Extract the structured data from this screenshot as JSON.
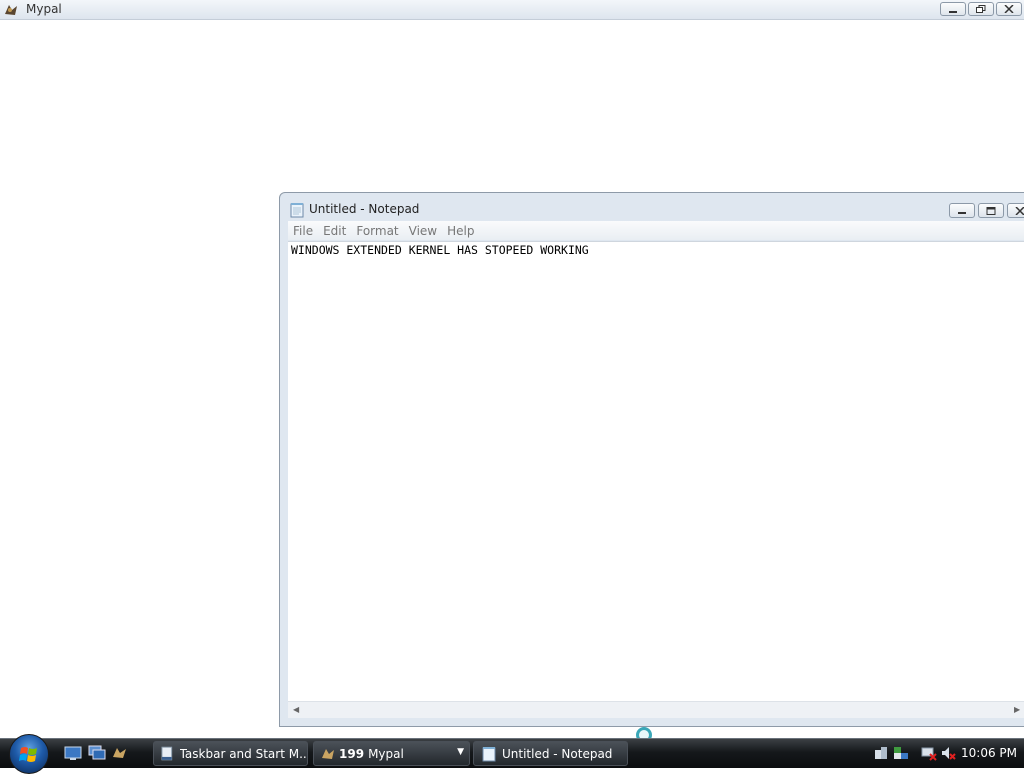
{
  "mypal": {
    "title": "Mypal"
  },
  "notepad": {
    "title": "Untitled - Notepad",
    "menus": [
      "File",
      "Edit",
      "Format",
      "View",
      "Help"
    ],
    "content": "WINDOWS EXTENDED KERNEL HAS STOPEED WORKING"
  },
  "taskbar": {
    "tasks": [
      {
        "label": "Taskbar and Start M..."
      },
      {
        "count": "199",
        "label": "Mypal"
      },
      {
        "label": "Untitled - Notepad"
      }
    ],
    "clock": "10:06 PM"
  },
  "icons": {
    "mypal": "mypal-logo-icon",
    "notepad": "notepad-icon",
    "start": "windows-logo-icon",
    "quicklaunch": [
      "show-desktop-icon",
      "switch-windows-icon",
      "mypal-icon"
    ],
    "tray": [
      "network-icon",
      "network-icon-2",
      "power-icon",
      "volume-muted-icon"
    ]
  },
  "colors": {
    "taskbar": "#15181b",
    "titlebar": "#dde5ee",
    "busy_cursor": "#3aa7b8"
  }
}
